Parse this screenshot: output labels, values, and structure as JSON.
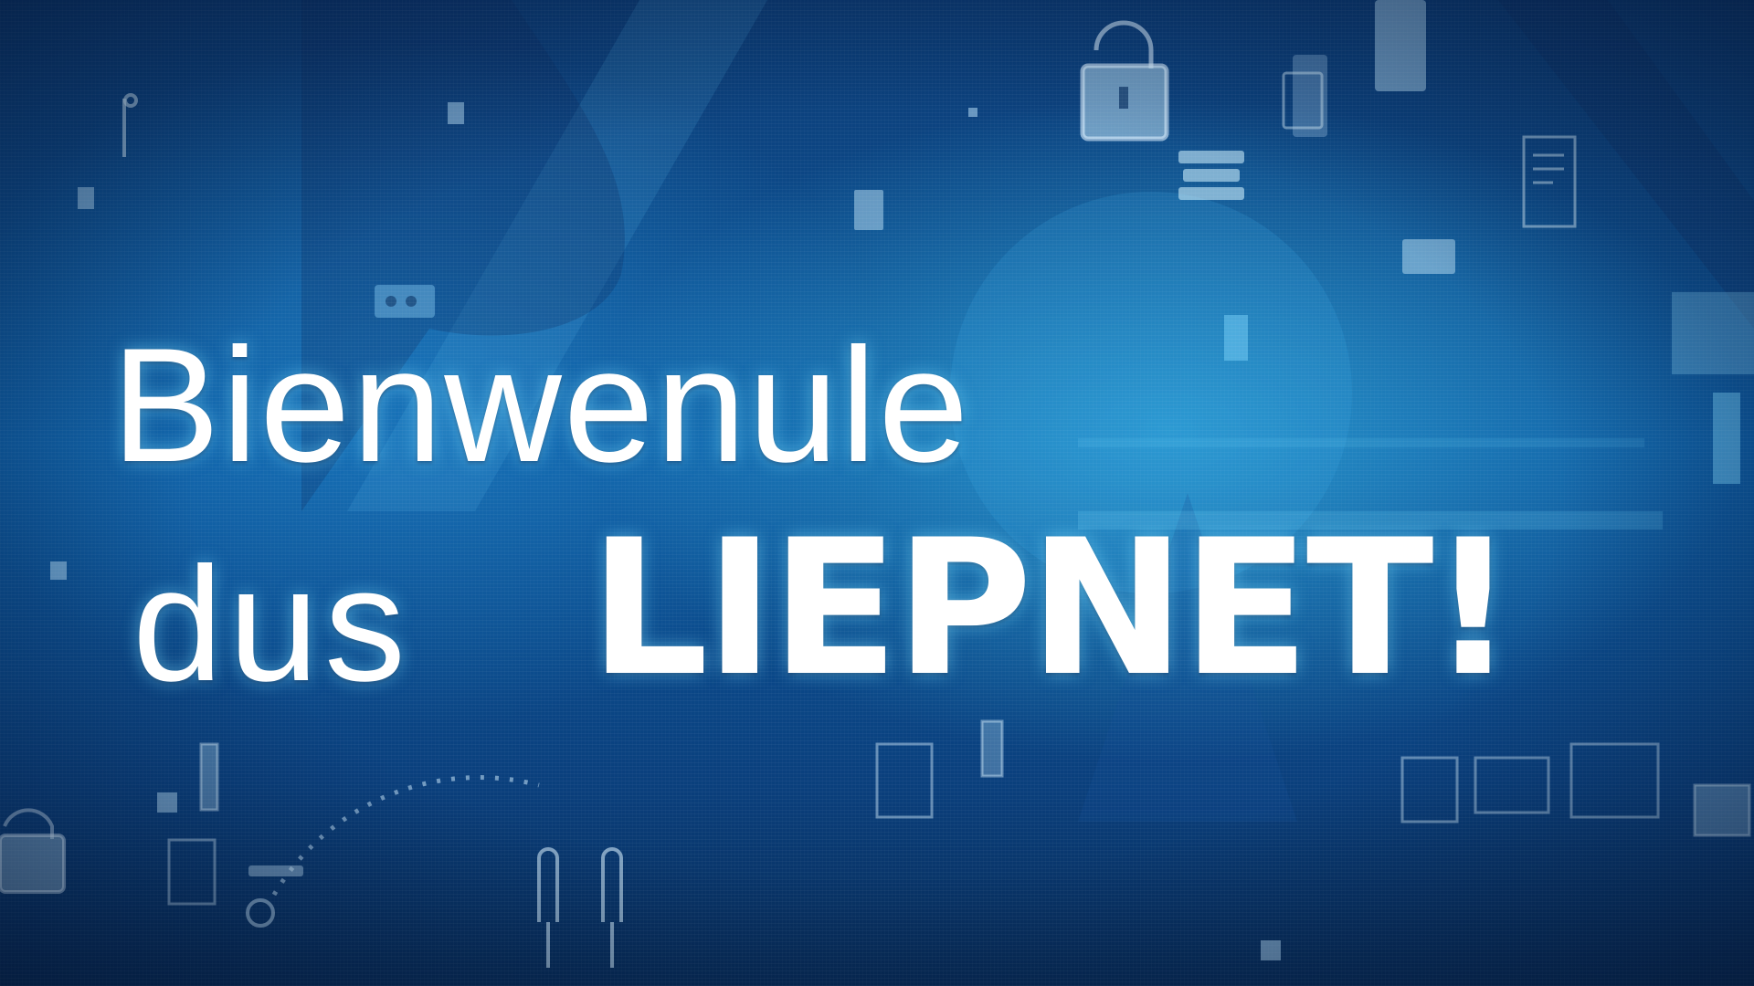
{
  "hero": {
    "line1": "Bienwenule",
    "line2_regular": "dus",
    "line2_bold": "LIEPNET!"
  },
  "colors": {
    "background_dark": "#0a2d5c",
    "background_mid": "#0d5aa0",
    "glow": "#40c8f5",
    "text": "#ffffff"
  },
  "decor_icons": [
    "padlock-icon",
    "tablet-icon",
    "card-icon",
    "document-icon",
    "server-icon",
    "gauge-icon",
    "connector-icon",
    "globe-silhouette"
  ]
}
